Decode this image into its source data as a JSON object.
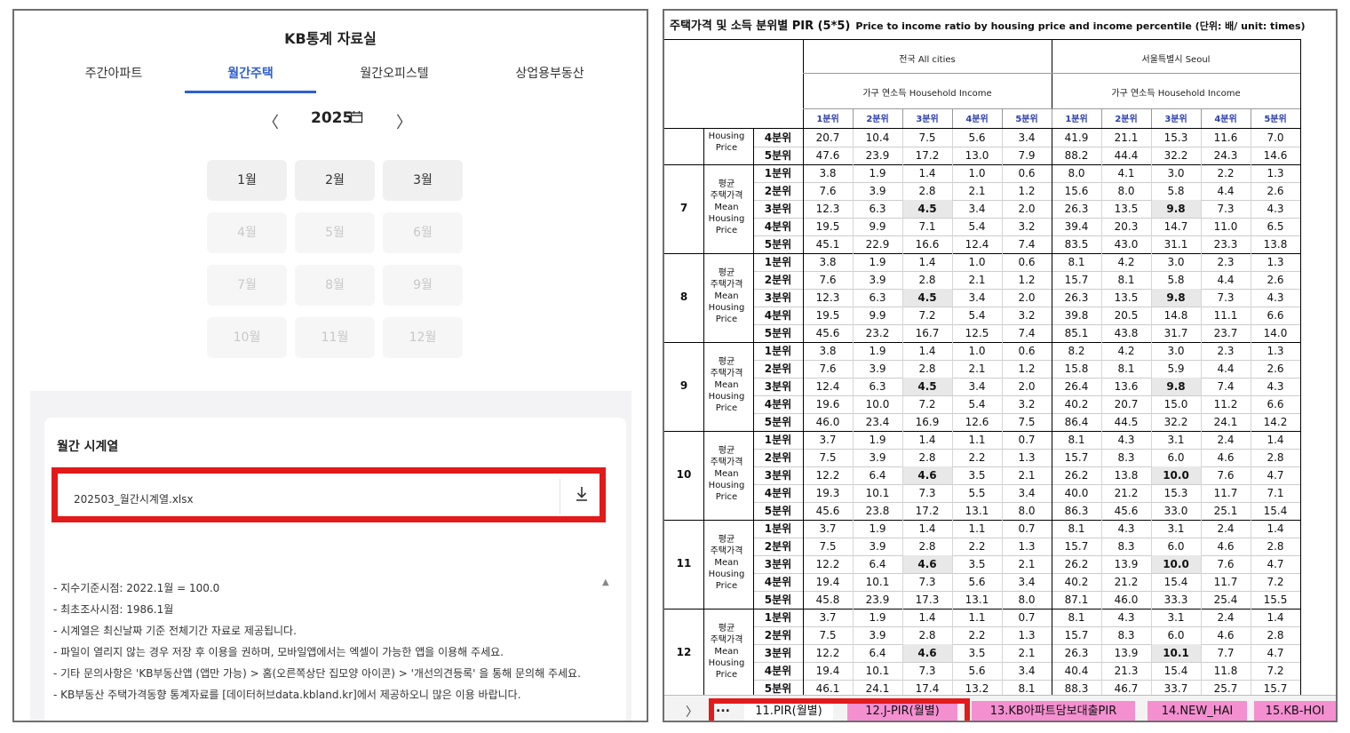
{
  "left": {
    "title": "KB통계 자료실",
    "tabs": [
      {
        "label": "주간아파트",
        "active": false
      },
      {
        "label": "월간주택",
        "active": true
      },
      {
        "label": "월간오피스텔",
        "active": false
      },
      {
        "label": "상업용부동산",
        "active": false
      }
    ],
    "year": "2025",
    "year_prev": "〈",
    "year_next": "〉",
    "calendar_icon": "calendar-icon",
    "months": [
      {
        "label": "1월",
        "enabled": true
      },
      {
        "label": "2월",
        "enabled": true
      },
      {
        "label": "3월",
        "enabled": true
      },
      {
        "label": "4월",
        "enabled": false
      },
      {
        "label": "5월",
        "enabled": false
      },
      {
        "label": "6월",
        "enabled": false
      },
      {
        "label": "7월",
        "enabled": false
      },
      {
        "label": "8월",
        "enabled": false
      },
      {
        "label": "9월",
        "enabled": false
      },
      {
        "label": "10월",
        "enabled": false
      },
      {
        "label": "11월",
        "enabled": false
      },
      {
        "label": "12월",
        "enabled": false
      }
    ],
    "section_title": "월간 시계열",
    "file_name": "202503_월간시계열.xlsx",
    "download_icon": "download-icon",
    "notes": [
      "- 지수기준시점: 2022.1월 = 100.0",
      "- 최초조사시점: 1986.1월",
      "- 시계열은 최신날짜 기준 전체기간 자료로 제공됩니다.",
      "- 파일이 열리지 않는 경우 저장 후 이용을 권하며, 모바일앱에서는 엑셀이 가능한 앱을 이용해 주세요.",
      "- 기타 문의사항은 'KB부동산앱 (앱만 가능) > 홈(오른쪽상단 집모양 아이콘) > '개선의견등록' 을 통해 문의해 주세요.",
      "- KB부동산 주택가격동향 통계자료를 [데이터허브data.kbland.kr]에서 제공하오니 많은 이용 바랍니다."
    ],
    "accent_color": "#2f5fd1",
    "highlight_color": "#e21a1a"
  },
  "right": {
    "title": "주택가격 및 소득 분위별 PIR (5*5)",
    "title_en": "Price to income ratio by housing price and income percentile  (단위: 배/ unit: times)",
    "region_all": "전국 All cities",
    "region_seoul": "서울특별시 Seoul",
    "income_header": "가구 연소득 Household Income",
    "income_quintiles": [
      "1분위",
      "2분위",
      "3분위",
      "4분위",
      "5분위"
    ],
    "partial_label": "Housing\nPrice",
    "group_label": "평균\n주택가격\nMean\nHousing\nPrice",
    "partial_rows": [
      {
        "q": "4분위",
        "all": [
          "20.7",
          "10.4",
          "7.5",
          "5.6",
          "3.4"
        ],
        "seoul": [
          "41.9",
          "21.1",
          "15.3",
          "11.6",
          "7.0"
        ]
      },
      {
        "q": "5분위",
        "all": [
          "47.6",
          "23.9",
          "17.2",
          "13.0",
          "7.9"
        ],
        "seoul": [
          "88.2",
          "44.4",
          "32.2",
          "24.3",
          "14.6"
        ]
      }
    ],
    "months": [
      {
        "month": "7",
        "rows": [
          {
            "q": "1분위",
            "all": [
              "3.8",
              "1.9",
              "1.4",
              "1.0",
              "0.6"
            ],
            "seoul": [
              "8.0",
              "4.1",
              "3.0",
              "2.2",
              "1.3"
            ]
          },
          {
            "q": "2분위",
            "all": [
              "7.6",
              "3.9",
              "2.8",
              "2.1",
              "1.2"
            ],
            "seoul": [
              "15.6",
              "8.0",
              "5.8",
              "4.4",
              "2.6"
            ]
          },
          {
            "q": "3분위",
            "all": [
              "12.3",
              "6.3",
              "4.5",
              "3.4",
              "2.0"
            ],
            "seoul": [
              "26.3",
              "13.5",
              "9.8",
              "7.3",
              "4.3"
            ]
          },
          {
            "q": "4분위",
            "all": [
              "19.5",
              "9.9",
              "7.1",
              "5.4",
              "3.2"
            ],
            "seoul": [
              "39.4",
              "20.3",
              "14.7",
              "11.0",
              "6.5"
            ]
          },
          {
            "q": "5분위",
            "all": [
              "45.1",
              "22.9",
              "16.6",
              "12.4",
              "7.4"
            ],
            "seoul": [
              "83.5",
              "43.0",
              "31.1",
              "23.3",
              "13.8"
            ]
          }
        ]
      },
      {
        "month": "8",
        "rows": [
          {
            "q": "1분위",
            "all": [
              "3.8",
              "1.9",
              "1.4",
              "1.0",
              "0.6"
            ],
            "seoul": [
              "8.1",
              "4.2",
              "3.0",
              "2.3",
              "1.3"
            ]
          },
          {
            "q": "2분위",
            "all": [
              "7.6",
              "3.9",
              "2.8",
              "2.1",
              "1.2"
            ],
            "seoul": [
              "15.7",
              "8.1",
              "5.8",
              "4.4",
              "2.6"
            ]
          },
          {
            "q": "3분위",
            "all": [
              "12.3",
              "6.3",
              "4.5",
              "3.4",
              "2.0"
            ],
            "seoul": [
              "26.3",
              "13.5",
              "9.8",
              "7.3",
              "4.3"
            ]
          },
          {
            "q": "4분위",
            "all": [
              "19.5",
              "9.9",
              "7.2",
              "5.4",
              "3.2"
            ],
            "seoul": [
              "39.8",
              "20.5",
              "14.8",
              "11.1",
              "6.6"
            ]
          },
          {
            "q": "5분위",
            "all": [
              "45.6",
              "23.2",
              "16.7",
              "12.5",
              "7.4"
            ],
            "seoul": [
              "85.1",
              "43.8",
              "31.7",
              "23.7",
              "14.0"
            ]
          }
        ]
      },
      {
        "month": "9",
        "rows": [
          {
            "q": "1분위",
            "all": [
              "3.8",
              "1.9",
              "1.4",
              "1.0",
              "0.6"
            ],
            "seoul": [
              "8.2",
              "4.2",
              "3.0",
              "2.3",
              "1.3"
            ]
          },
          {
            "q": "2분위",
            "all": [
              "7.6",
              "3.9",
              "2.8",
              "2.1",
              "1.2"
            ],
            "seoul": [
              "15.8",
              "8.1",
              "5.9",
              "4.4",
              "2.6"
            ]
          },
          {
            "q": "3분위",
            "all": [
              "12.4",
              "6.3",
              "4.5",
              "3.4",
              "2.0"
            ],
            "seoul": [
              "26.4",
              "13.6",
              "9.8",
              "7.4",
              "4.3"
            ]
          },
          {
            "q": "4분위",
            "all": [
              "19.6",
              "10.0",
              "7.2",
              "5.4",
              "3.2"
            ],
            "seoul": [
              "40.2",
              "20.7",
              "15.0",
              "11.2",
              "6.6"
            ]
          },
          {
            "q": "5분위",
            "all": [
              "46.0",
              "23.4",
              "16.9",
              "12.6",
              "7.5"
            ],
            "seoul": [
              "86.4",
              "44.5",
              "32.2",
              "24.1",
              "14.2"
            ]
          }
        ]
      },
      {
        "month": "10",
        "rows": [
          {
            "q": "1분위",
            "all": [
              "3.7",
              "1.9",
              "1.4",
              "1.1",
              "0.7"
            ],
            "seoul": [
              "8.1",
              "4.3",
              "3.1",
              "2.4",
              "1.4"
            ]
          },
          {
            "q": "2분위",
            "all": [
              "7.5",
              "3.9",
              "2.8",
              "2.2",
              "1.3"
            ],
            "seoul": [
              "15.7",
              "8.3",
              "6.0",
              "4.6",
              "2.8"
            ]
          },
          {
            "q": "3분위",
            "all": [
              "12.2",
              "6.4",
              "4.6",
              "3.5",
              "2.1"
            ],
            "seoul": [
              "26.2",
              "13.8",
              "10.0",
              "7.6",
              "4.7"
            ]
          },
          {
            "q": "4분위",
            "all": [
              "19.3",
              "10.1",
              "7.3",
              "5.5",
              "3.4"
            ],
            "seoul": [
              "40.0",
              "21.2",
              "15.3",
              "11.7",
              "7.1"
            ]
          },
          {
            "q": "5분위",
            "all": [
              "45.6",
              "23.8",
              "17.2",
              "13.1",
              "8.0"
            ],
            "seoul": [
              "86.3",
              "45.6",
              "33.0",
              "25.1",
              "15.4"
            ]
          }
        ]
      },
      {
        "month": "11",
        "rows": [
          {
            "q": "1분위",
            "all": [
              "3.7",
              "1.9",
              "1.4",
              "1.1",
              "0.7"
            ],
            "seoul": [
              "8.1",
              "4.3",
              "3.1",
              "2.4",
              "1.4"
            ]
          },
          {
            "q": "2분위",
            "all": [
              "7.5",
              "3.9",
              "2.8",
              "2.2",
              "1.3"
            ],
            "seoul": [
              "15.7",
              "8.3",
              "6.0",
              "4.6",
              "2.8"
            ]
          },
          {
            "q": "3분위",
            "all": [
              "12.2",
              "6.4",
              "4.6",
              "3.5",
              "2.1"
            ],
            "seoul": [
              "26.2",
              "13.9",
              "10.0",
              "7.6",
              "4.7"
            ]
          },
          {
            "q": "4분위",
            "all": [
              "19.4",
              "10.1",
              "7.3",
              "5.6",
              "3.4"
            ],
            "seoul": [
              "40.2",
              "21.2",
              "15.4",
              "11.7",
              "7.2"
            ]
          },
          {
            "q": "5분위",
            "all": [
              "45.8",
              "23.9",
              "17.3",
              "13.1",
              "8.0"
            ],
            "seoul": [
              "87.1",
              "46.0",
              "33.3",
              "25.4",
              "15.5"
            ]
          }
        ]
      },
      {
        "month": "12",
        "rows": [
          {
            "q": "1분위",
            "all": [
              "3.7",
              "1.9",
              "1.4",
              "1.1",
              "0.7"
            ],
            "seoul": [
              "8.1",
              "4.3",
              "3.1",
              "2.4",
              "1.4"
            ]
          },
          {
            "q": "2분위",
            "all": [
              "7.5",
              "3.9",
              "2.8",
              "2.2",
              "1.3"
            ],
            "seoul": [
              "15.7",
              "8.3",
              "6.0",
              "4.6",
              "2.8"
            ]
          },
          {
            "q": "3분위",
            "all": [
              "12.2",
              "6.4",
              "4.6",
              "3.5",
              "2.1"
            ],
            "seoul": [
              "26.3",
              "13.9",
              "10.1",
              "7.7",
              "4.7"
            ]
          },
          {
            "q": "4분위",
            "all": [
              "19.4",
              "10.1",
              "7.3",
              "5.6",
              "3.4"
            ],
            "seoul": [
              "40.4",
              "21.3",
              "15.4",
              "11.8",
              "7.2"
            ]
          },
          {
            "q": "5분위",
            "all": [
              "46.1",
              "24.1",
              "17.4",
              "13.2",
              "8.1"
            ],
            "seoul": [
              "88.3",
              "46.7",
              "33.7",
              "25.7",
              "15.7"
            ]
          }
        ]
      }
    ],
    "sheet_tabs": [
      {
        "label": "11.PIR(월별)",
        "color": "#ffffff"
      },
      {
        "label": "12.J-PIR(월별)",
        "color": "#f48fd0"
      },
      {
        "label": "13.KB아파트담보대출PIR",
        "color": "#f48fd0"
      },
      {
        "label": "14.NEW_HAI",
        "color": "#f48fd0"
      },
      {
        "label": "15.KB-HOI",
        "color": "#f48fd0"
      }
    ],
    "tab_more": "...",
    "tab_scroll": "〉"
  }
}
